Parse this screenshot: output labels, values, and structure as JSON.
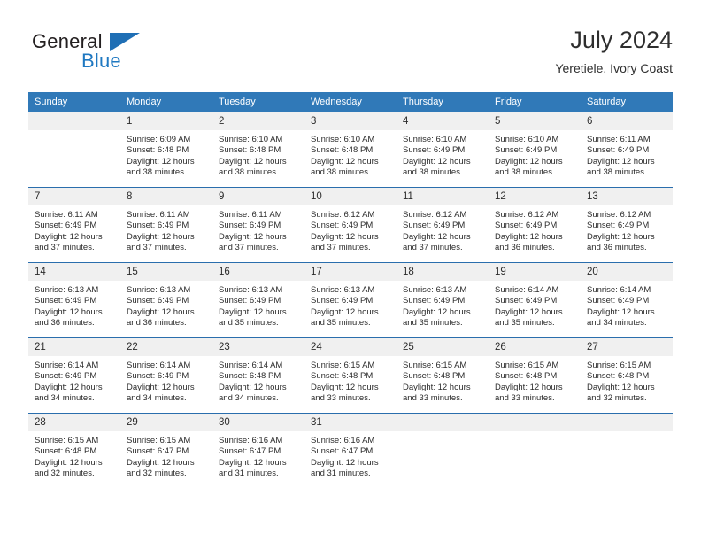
{
  "brand": {
    "name_part1": "General",
    "name_part2": "Blue",
    "logo_icon": "triangle-flag-icon",
    "color_primary": "#1f6fb5",
    "color_text": "#231f20"
  },
  "header": {
    "title": "July 2024",
    "subtitle": "Yeretiele, Ivory Coast"
  },
  "theme": {
    "header_row_bg": "#3079b8",
    "row_border": "#2a6ead",
    "daynum_bg": "#f0f0f0",
    "text": "#2b2b2b"
  },
  "columns": [
    "Sunday",
    "Monday",
    "Tuesday",
    "Wednesday",
    "Thursday",
    "Friday",
    "Saturday"
  ],
  "weeks": [
    [
      {
        "day": "",
        "lines": []
      },
      {
        "day": "1",
        "lines": [
          "Sunrise: 6:09 AM",
          "Sunset: 6:48 PM",
          "Daylight: 12 hours",
          "and 38 minutes."
        ]
      },
      {
        "day": "2",
        "lines": [
          "Sunrise: 6:10 AM",
          "Sunset: 6:48 PM",
          "Daylight: 12 hours",
          "and 38 minutes."
        ]
      },
      {
        "day": "3",
        "lines": [
          "Sunrise: 6:10 AM",
          "Sunset: 6:48 PM",
          "Daylight: 12 hours",
          "and 38 minutes."
        ]
      },
      {
        "day": "4",
        "lines": [
          "Sunrise: 6:10 AM",
          "Sunset: 6:49 PM",
          "Daylight: 12 hours",
          "and 38 minutes."
        ]
      },
      {
        "day": "5",
        "lines": [
          "Sunrise: 6:10 AM",
          "Sunset: 6:49 PM",
          "Daylight: 12 hours",
          "and 38 minutes."
        ]
      },
      {
        "day": "6",
        "lines": [
          "Sunrise: 6:11 AM",
          "Sunset: 6:49 PM",
          "Daylight: 12 hours",
          "and 38 minutes."
        ]
      }
    ],
    [
      {
        "day": "7",
        "lines": [
          "Sunrise: 6:11 AM",
          "Sunset: 6:49 PM",
          "Daylight: 12 hours",
          "and 37 minutes."
        ]
      },
      {
        "day": "8",
        "lines": [
          "Sunrise: 6:11 AM",
          "Sunset: 6:49 PM",
          "Daylight: 12 hours",
          "and 37 minutes."
        ]
      },
      {
        "day": "9",
        "lines": [
          "Sunrise: 6:11 AM",
          "Sunset: 6:49 PM",
          "Daylight: 12 hours",
          "and 37 minutes."
        ]
      },
      {
        "day": "10",
        "lines": [
          "Sunrise: 6:12 AM",
          "Sunset: 6:49 PM",
          "Daylight: 12 hours",
          "and 37 minutes."
        ]
      },
      {
        "day": "11",
        "lines": [
          "Sunrise: 6:12 AM",
          "Sunset: 6:49 PM",
          "Daylight: 12 hours",
          "and 37 minutes."
        ]
      },
      {
        "day": "12",
        "lines": [
          "Sunrise: 6:12 AM",
          "Sunset: 6:49 PM",
          "Daylight: 12 hours",
          "and 36 minutes."
        ]
      },
      {
        "day": "13",
        "lines": [
          "Sunrise: 6:12 AM",
          "Sunset: 6:49 PM",
          "Daylight: 12 hours",
          "and 36 minutes."
        ]
      }
    ],
    [
      {
        "day": "14",
        "lines": [
          "Sunrise: 6:13 AM",
          "Sunset: 6:49 PM",
          "Daylight: 12 hours",
          "and 36 minutes."
        ]
      },
      {
        "day": "15",
        "lines": [
          "Sunrise: 6:13 AM",
          "Sunset: 6:49 PM",
          "Daylight: 12 hours",
          "and 36 minutes."
        ]
      },
      {
        "day": "16",
        "lines": [
          "Sunrise: 6:13 AM",
          "Sunset: 6:49 PM",
          "Daylight: 12 hours",
          "and 35 minutes."
        ]
      },
      {
        "day": "17",
        "lines": [
          "Sunrise: 6:13 AM",
          "Sunset: 6:49 PM",
          "Daylight: 12 hours",
          "and 35 minutes."
        ]
      },
      {
        "day": "18",
        "lines": [
          "Sunrise: 6:13 AM",
          "Sunset: 6:49 PM",
          "Daylight: 12 hours",
          "and 35 minutes."
        ]
      },
      {
        "day": "19",
        "lines": [
          "Sunrise: 6:14 AM",
          "Sunset: 6:49 PM",
          "Daylight: 12 hours",
          "and 35 minutes."
        ]
      },
      {
        "day": "20",
        "lines": [
          "Sunrise: 6:14 AM",
          "Sunset: 6:49 PM",
          "Daylight: 12 hours",
          "and 34 minutes."
        ]
      }
    ],
    [
      {
        "day": "21",
        "lines": [
          "Sunrise: 6:14 AM",
          "Sunset: 6:49 PM",
          "Daylight: 12 hours",
          "and 34 minutes."
        ]
      },
      {
        "day": "22",
        "lines": [
          "Sunrise: 6:14 AM",
          "Sunset: 6:49 PM",
          "Daylight: 12 hours",
          "and 34 minutes."
        ]
      },
      {
        "day": "23",
        "lines": [
          "Sunrise: 6:14 AM",
          "Sunset: 6:48 PM",
          "Daylight: 12 hours",
          "and 34 minutes."
        ]
      },
      {
        "day": "24",
        "lines": [
          "Sunrise: 6:15 AM",
          "Sunset: 6:48 PM",
          "Daylight: 12 hours",
          "and 33 minutes."
        ]
      },
      {
        "day": "25",
        "lines": [
          "Sunrise: 6:15 AM",
          "Sunset: 6:48 PM",
          "Daylight: 12 hours",
          "and 33 minutes."
        ]
      },
      {
        "day": "26",
        "lines": [
          "Sunrise: 6:15 AM",
          "Sunset: 6:48 PM",
          "Daylight: 12 hours",
          "and 33 minutes."
        ]
      },
      {
        "day": "27",
        "lines": [
          "Sunrise: 6:15 AM",
          "Sunset: 6:48 PM",
          "Daylight: 12 hours",
          "and 32 minutes."
        ]
      }
    ],
    [
      {
        "day": "28",
        "lines": [
          "Sunrise: 6:15 AM",
          "Sunset: 6:48 PM",
          "Daylight: 12 hours",
          "and 32 minutes."
        ]
      },
      {
        "day": "29",
        "lines": [
          "Sunrise: 6:15 AM",
          "Sunset: 6:47 PM",
          "Daylight: 12 hours",
          "and 32 minutes."
        ]
      },
      {
        "day": "30",
        "lines": [
          "Sunrise: 6:16 AM",
          "Sunset: 6:47 PM",
          "Daylight: 12 hours",
          "and 31 minutes."
        ]
      },
      {
        "day": "31",
        "lines": [
          "Sunrise: 6:16 AM",
          "Sunset: 6:47 PM",
          "Daylight: 12 hours",
          "and 31 minutes."
        ]
      },
      {
        "day": "",
        "lines": []
      },
      {
        "day": "",
        "lines": []
      },
      {
        "day": "",
        "lines": []
      }
    ]
  ]
}
